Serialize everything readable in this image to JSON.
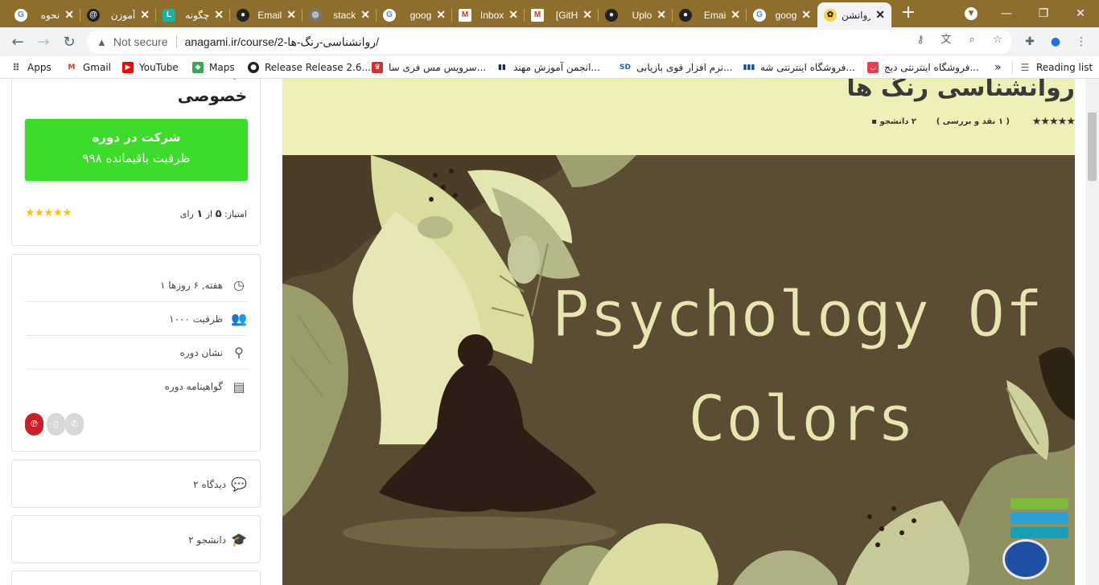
{
  "tabs": [
    {
      "title": "نحوه",
      "favicon": "google-icon"
    },
    {
      "title": "آموزن",
      "favicon": "threads-icon"
    },
    {
      "title": "چگونه",
      "favicon": "app-icon"
    },
    {
      "title": "Email",
      "favicon": "github-icon"
    },
    {
      "title": "stack",
      "favicon": "globe-icon"
    },
    {
      "title": "goog",
      "favicon": "google-icon"
    },
    {
      "title": "Inbox",
      "favicon": "gmail-icon"
    },
    {
      "title": "[GitH",
      "favicon": "gmail-icon"
    },
    {
      "title": "Uplo",
      "favicon": "github-icon"
    },
    {
      "title": "Emai",
      "favicon": "github-icon"
    },
    {
      "title": "goog",
      "favicon": "google-icon"
    },
    {
      "title": "روانشن",
      "favicon": "bee-icon",
      "active": true
    }
  ],
  "address_bar": {
    "security": "Not secure",
    "url": "anagami.ir/course/2-روانشناسی-رنگ-ها/"
  },
  "bookmarks": [
    {
      "label": "Apps",
      "icon": "apps-grid-icon"
    },
    {
      "label": "Gmail",
      "icon": "gmail-icon"
    },
    {
      "label": "YouTube",
      "icon": "youtube-icon"
    },
    {
      "label": "Maps",
      "icon": "maps-icon"
    },
    {
      "label": "Release Release 2.6....",
      "icon": "github-icon"
    },
    {
      "label": "سرویس مس فری سا...",
      "icon": "crown-icon"
    },
    {
      "label": "انجمن آموزش مهند...",
      "icon": "engineering-icon"
    },
    {
      "label": "نرم افزار قوی بازیابی...",
      "icon": "recovery-icon"
    },
    {
      "label": "فروشگاه اینترنتی شه...",
      "icon": "shop-icon"
    },
    {
      "label": "فروشگاه اینترنتی دیج...",
      "icon": "digikala-icon"
    }
  ],
  "bookmarks_overflow": "»",
  "reading_list": "Reading list",
  "sidebar": {
    "price_cut": "ـ",
    "price_label": "خصوصی",
    "enroll_label": "شرکت در دوره",
    "capacity_left": "۹۹۸ ظرفیت باقیمانده",
    "rating_stars": "★★★★★",
    "rating_label": "امتیاز:",
    "rating_value": "۵",
    "rating_of": "از",
    "rating_count": "۱",
    "rating_votes": "رای",
    "info": [
      {
        "label": "۱ هفته, ۶ روزها",
        "icon": "clock-icon"
      },
      {
        "label": "۱۰۰۰ ظرفیت",
        "icon": "users-icon"
      },
      {
        "label": "نشان دوره",
        "icon": "badge-icon"
      },
      {
        "label": "گواهینامه دوره",
        "icon": "certificate-icon"
      }
    ],
    "comments": "۲ دیدگاه",
    "students": "۲ دانشجو"
  },
  "course": {
    "title": "روانشناسی رنگ ها",
    "reviews": "( ۱ نقد و بررسی )",
    "students": "۲ دانشجو",
    "stars": "★★★★★",
    "hero_line1": "Psychology Of",
    "hero_line2": "Colors"
  },
  "colors": {
    "tabstrip": "#8e6e2c",
    "enroll_button": "#3ddb2b",
    "course_header_bg": "#eef0b8",
    "hero_bg": "#5b4c34",
    "hero_text": "#e8e6b0",
    "star": "#f5c518"
  }
}
